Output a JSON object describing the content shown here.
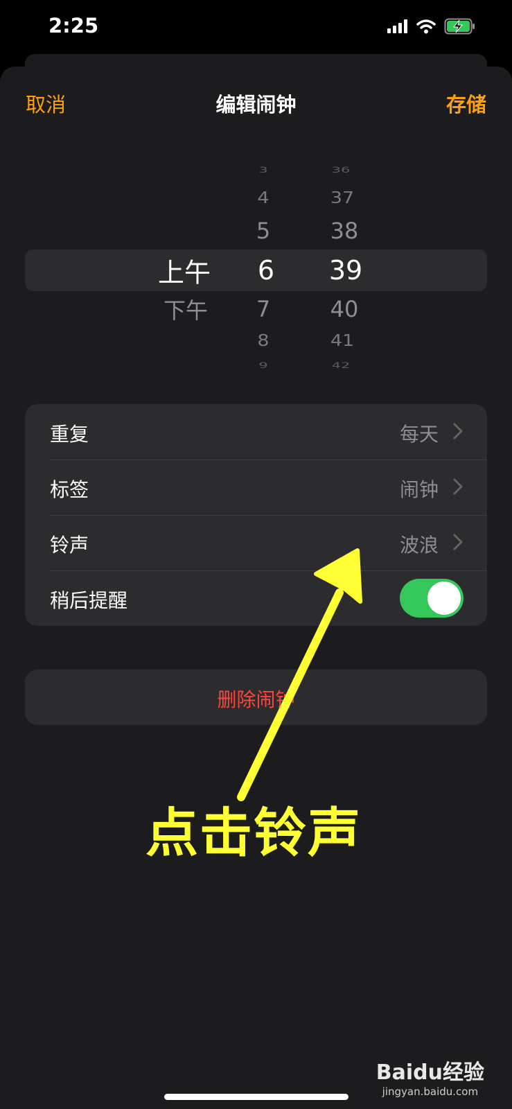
{
  "status_bar": {
    "time": "2:25"
  },
  "nav": {
    "cancel_label": "取消",
    "title": "编辑闹钟",
    "save_label": "存储"
  },
  "time_picker": {
    "period": {
      "items": [
        "上午",
        "下午"
      ],
      "selected": "上午"
    },
    "hour": {
      "items": [
        "3",
        "4",
        "5",
        "6",
        "7",
        "8",
        "9"
      ],
      "selected": "6"
    },
    "minute": {
      "items": [
        "36",
        "37",
        "38",
        "39",
        "40",
        "41",
        "42"
      ],
      "selected": "39"
    }
  },
  "settings": {
    "repeat": {
      "label": "重复",
      "value": "每天"
    },
    "tag": {
      "label": "标签",
      "value": "闹钟"
    },
    "ringtone": {
      "label": "铃声",
      "value": "波浪"
    },
    "snooze": {
      "label": "稍后提醒",
      "enabled": true
    }
  },
  "delete_label": "删除闹钟",
  "annotation": {
    "text": "点击铃声",
    "color": "#ffff33"
  },
  "watermark": {
    "logo": "Baidu经验",
    "site": "jingyan.baidu.com"
  },
  "colors": {
    "accent": "#ff9f0a",
    "destructive": "#ff453a",
    "toggle_on": "#34c759"
  }
}
